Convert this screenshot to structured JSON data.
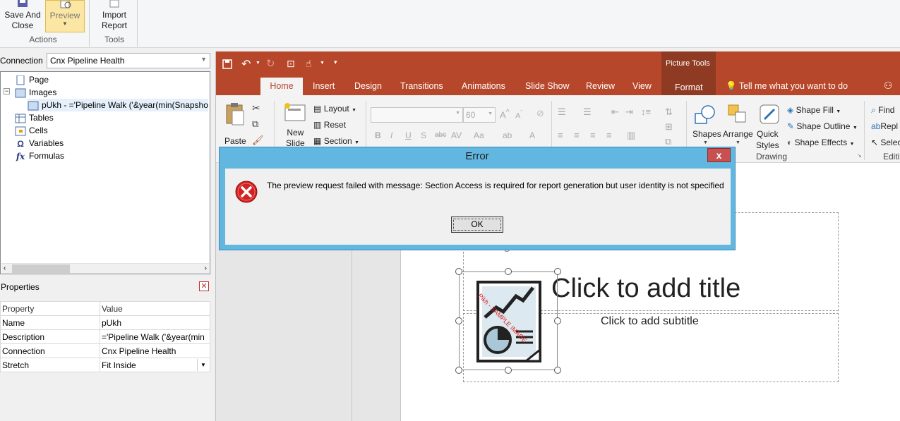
{
  "host_ribbon": {
    "save_close": "Save And\nClose",
    "preview": "Preview",
    "import_report": "Import\nReport",
    "group_actions": "Actions",
    "group_tools": "Tools"
  },
  "connection": {
    "label": "Connection",
    "value": "Cnx Pipeline Health"
  },
  "tree": {
    "page": "Page",
    "images": "Images",
    "image_item": "pUkh - ='Pipeline Walk ('&year(min(Snapsho",
    "tables": "Tables",
    "cells": "Cells",
    "variables": "Variables",
    "formulas": "Formulas"
  },
  "properties": {
    "title": "Properties",
    "col_property": "Property",
    "col_value": "Value",
    "rows": [
      {
        "name": "Name",
        "value": "pUkh"
      },
      {
        "name": "Description",
        "value": "='Pipeline Walk ('&year(min"
      },
      {
        "name": "Connection",
        "value": "Cnx Pipeline Health"
      },
      {
        "name": "Stretch",
        "value": "Fit Inside"
      }
    ]
  },
  "ppt": {
    "picture_tools": "Picture Tools",
    "tabs": [
      "Home",
      "Insert",
      "Design",
      "Transitions",
      "Animations",
      "Slide Show",
      "Review",
      "View",
      "Format"
    ],
    "tell_me": "Tell me what you want to do",
    "paste": "Paste",
    "new_slide": "New\nSlide",
    "layout": "Layout",
    "reset": "Reset",
    "section": "Section",
    "font_size": "60",
    "shapes": "Shapes",
    "arrange": "Arrange",
    "quick_styles": "Quick\nStyles",
    "shape_fill": "Shape Fill",
    "shape_outline": "Shape Outline",
    "shape_effects": "Shape Effects",
    "group_drawing": "Drawing",
    "find": "Find",
    "replace": "Repl",
    "select": "Selec",
    "group_editing": "Editi",
    "slide_title": "Click to add title",
    "slide_subtitle": "Click to add subtitle",
    "image_watermark": "Pikh - SAMPLE IMAGE"
  },
  "dialog": {
    "title": "Error",
    "close": "x",
    "message": "The preview request failed with message: Section Access is required for report generation but user identity is not specified",
    "ok": "OK"
  }
}
